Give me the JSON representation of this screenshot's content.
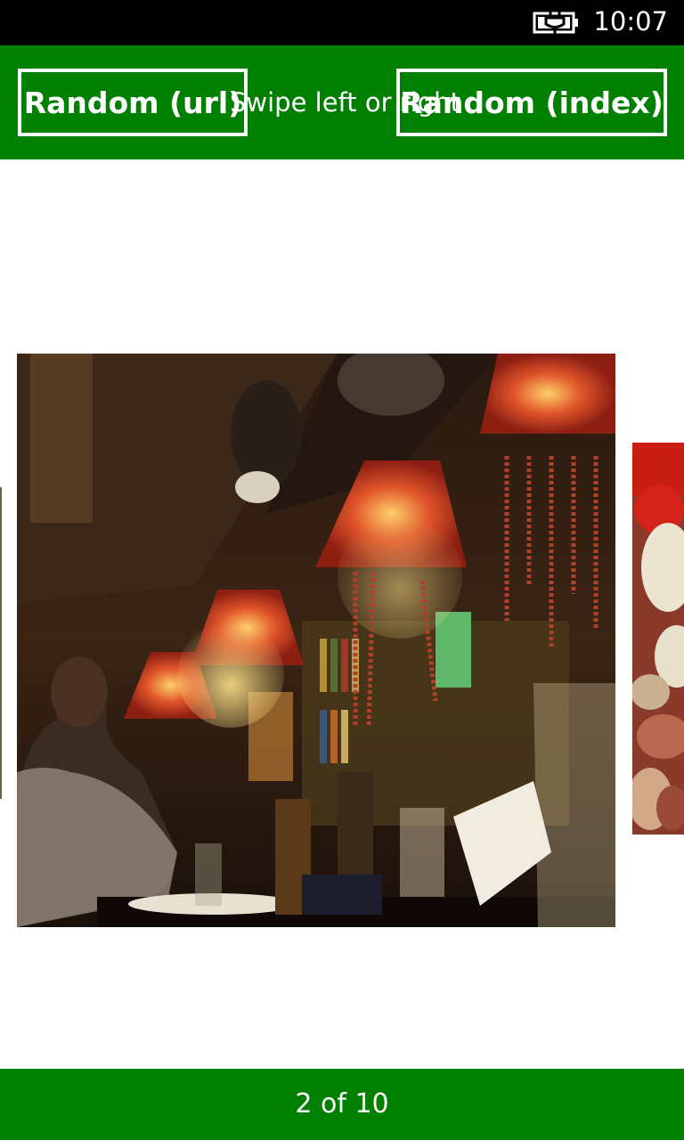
{
  "status_bar": {
    "time": "10:07",
    "battery_icon": "battery-charging-icon"
  },
  "header": {
    "random_url_label": "Random (url)",
    "swipe_hint": "Swipe left or right",
    "random_index_label": "Random (index)"
  },
  "gallery": {
    "current_image": "bar-interior-with-lamps-photo",
    "next_image": "food-platter-photo"
  },
  "footer": {
    "page_indicator": "2 of 10"
  },
  "colors": {
    "accent_green": "#008000",
    "status_bar_bg": "#000000"
  }
}
